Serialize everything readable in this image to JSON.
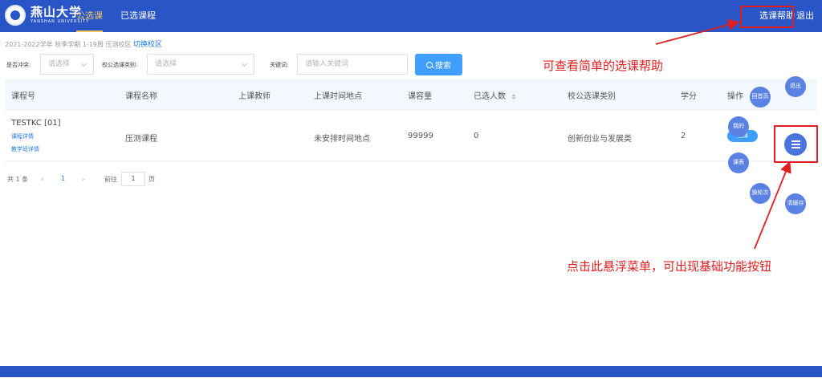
{
  "header": {
    "logo_cn": "燕山大学",
    "logo_en": "YANSHAN UNIVERSITY",
    "tabs": [
      {
        "label": "公选课",
        "active": true
      },
      {
        "label": "已选课程",
        "active": false
      }
    ],
    "help_label": "选课帮助",
    "logout_label": "退出",
    "colors": {
      "primary": "#2a55c7",
      "active_tab": "#f3c85a"
    }
  },
  "term": {
    "info": "2021-2022学年 秋季学期  1-19周  压测校区",
    "switch_link": "切换校区"
  },
  "filters": {
    "conflict_label": "是否冲突:",
    "conflict_placeholder": "请选择",
    "category_label": "校公选课类别:",
    "category_placeholder": "请选择",
    "keyword_label": "关键词:",
    "keyword_placeholder": "请输入关键词",
    "search_label": "搜索"
  },
  "table": {
    "columns": [
      "课程号",
      "课程名称",
      "上课教师",
      "上课时间地点",
      "课容量",
      "已选人数",
      "校公选课类别",
      "学分",
      "操作"
    ],
    "rows": [
      {
        "code": "TESTKC [01]",
        "detail_link": "课程详情",
        "class_link": "教学班详情",
        "name": "压测课程",
        "teacher": "",
        "time_place": "未安排时间地点",
        "capacity": "99999",
        "selected": "0",
        "category": "创新创业与发展类",
        "credit": "2",
        "action": "选择"
      }
    ]
  },
  "pager": {
    "total": "共 1 条",
    "current": "1",
    "goto_label": "前往",
    "goto_value": "1",
    "page_suffix": "页"
  },
  "float_menu": {
    "buttons": {
      "logout": "退出",
      "home": "回首页",
      "mine": "我的",
      "timetable": "课表",
      "switch_round": "换轮次",
      "clear_cache": "清缓存"
    },
    "menu_icon": "menu-icon"
  },
  "annotations": {
    "help_note": "可查看简单的选课帮助",
    "menu_note": "点击此悬浮菜单，可出现基础功能按钮",
    "color": "#e02020"
  }
}
